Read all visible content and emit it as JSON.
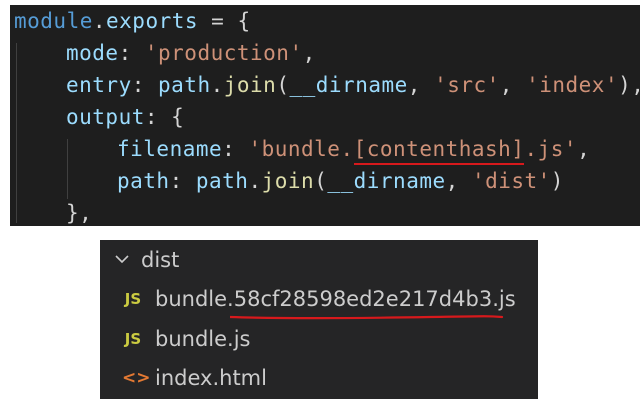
{
  "editor": {
    "line1": {
      "module": "module",
      "dot": ".",
      "exports": "exports",
      "assign": " = {"
    },
    "line2": {
      "key": "mode",
      "colon": ": ",
      "value": "'production'",
      "comma": ","
    },
    "line3": {
      "key": "entry",
      "colon": ": ",
      "obj": "path",
      "dot": ".",
      "fn": "join",
      "open": "(",
      "arg1": "__dirname",
      "sep1": ", ",
      "arg2": "'src'",
      "sep2": ", ",
      "arg3": "'index'",
      "close": "),"
    },
    "line4": {
      "key": "output",
      "colon": ": ",
      "brace": "{"
    },
    "line5": {
      "key": "filename",
      "colon": ": ",
      "value_pre": "'bundle.",
      "value_hash": "[contenthash]",
      "value_post": ".js'",
      "comma": ","
    },
    "line6": {
      "key": "path",
      "colon": ": ",
      "obj": "path",
      "dot": ".",
      "fn": "join",
      "open": "(",
      "arg1": "__dirname",
      "sep1": ", ",
      "arg2": "'dist'",
      "close": ")"
    },
    "line7": {
      "close": "},"
    }
  },
  "explorer": {
    "folder": {
      "name": "dist",
      "icon": "chevron-down-icon"
    },
    "files": [
      {
        "name_pre": "bundle.",
        "name_hash": "58cf28598ed2e217d4b3",
        "name_post": ".js",
        "icon_text": "JS",
        "icon": "javascript-file-icon"
      },
      {
        "name": "bundle.js",
        "icon_text": "JS",
        "icon": "javascript-file-icon"
      },
      {
        "name": "index.html",
        "icon_text": "<>",
        "icon": "html-file-icon"
      }
    ]
  },
  "colors": {
    "editor_bg": "#1e1e1e",
    "explorer_bg": "#252526",
    "keyword": "#569cd6",
    "property": "#9cdcfe",
    "function": "#dcdcaa",
    "string": "#ce9178",
    "annotation_red": "#d7191c",
    "js_icon": "#cbcb41",
    "html_icon": "#e37933"
  }
}
